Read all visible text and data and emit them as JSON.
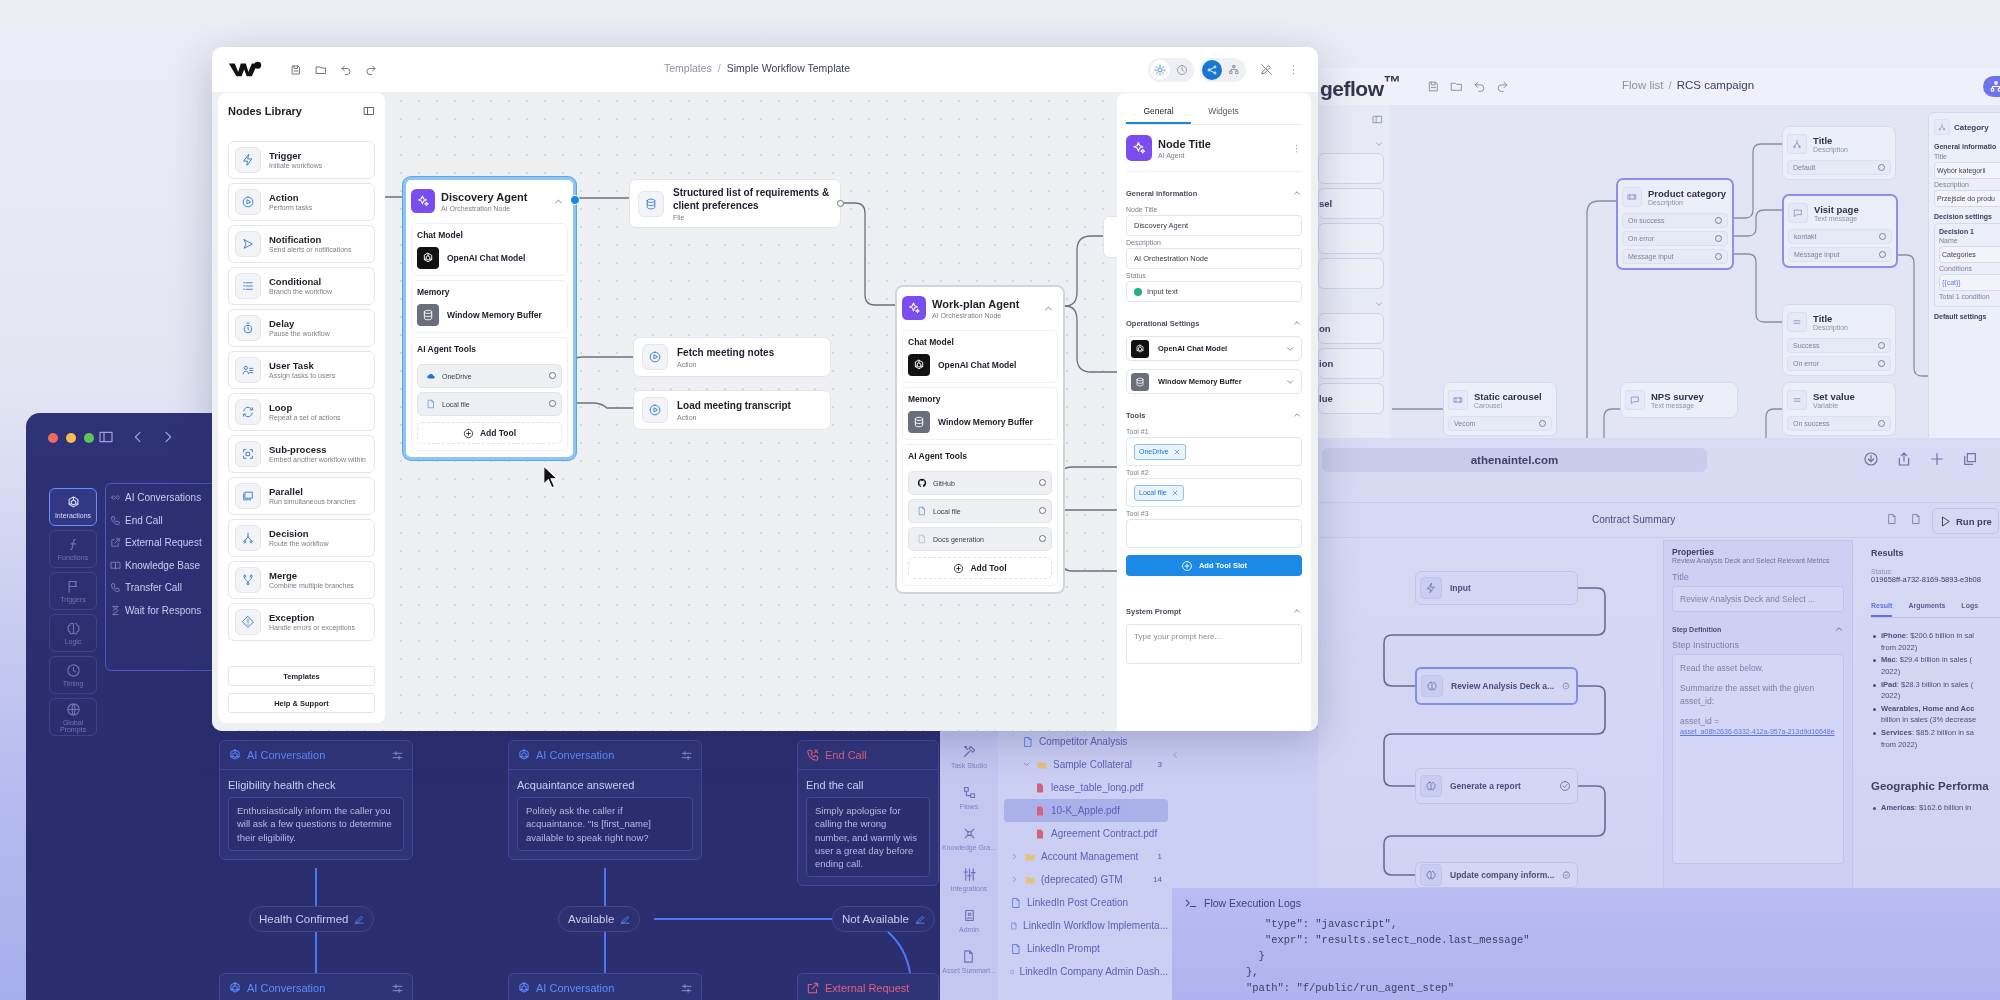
{
  "dark_window": {
    "rail": [
      {
        "kind": "ai",
        "label": "Interactions",
        "selected": true
      },
      {
        "kind": "function",
        "label": "Functions",
        "selected": false
      },
      {
        "kind": "flag",
        "label": "Triggers",
        "selected": false
      },
      {
        "kind": "brain",
        "label": "Logic",
        "selected": false
      },
      {
        "kind": "clock",
        "label": "Timing",
        "selected": false
      },
      {
        "kind": "globe",
        "label": "Global Prompts",
        "selected": false
      }
    ],
    "menu": [
      {
        "kind": "infinity",
        "label": "AI Conversations"
      },
      {
        "kind": "phone",
        "label": "End Call"
      },
      {
        "kind": "external",
        "label": "External Request"
      },
      {
        "kind": "book",
        "label": "Knowledge Base"
      },
      {
        "kind": "phone",
        "label": "Transfer Call"
      },
      {
        "kind": "hourglass",
        "label": "Wait for Respons"
      }
    ],
    "cards": [
      {
        "kind": "ai",
        "type": "AI Conversation",
        "title": "Eligibility health check",
        "body": "Enthusiastically inform the caller you will ask a few questions to determine their eligibility."
      },
      {
        "kind": "ai",
        "type": "AI Conversation",
        "title": "Acquaintance answered",
        "body": "Politely ask the caller if acquaintance. \"Is [first_name] available to speak right now?"
      },
      {
        "kind": "end",
        "type": "End Call",
        "title": "End the call",
        "body": "Simply apologise for calling the wrong number, and warmly wis user a great day before ending call."
      }
    ],
    "branches": [
      "Health Confirmed",
      "Available",
      "Not Available"
    ],
    "next_cards": [
      {
        "kind": "ai",
        "type": "AI Conversation"
      },
      {
        "kind": "ai",
        "type": "AI Conversation"
      },
      {
        "kind": "external",
        "type": "External Request"
      }
    ]
  },
  "main_window": {
    "breadcrumb": [
      "Templates",
      "Simple Workflow Template"
    ],
    "breadcrumb_separator": "/",
    "view_toggles": [
      {
        "kind": "sun",
        "selected": true
      },
      {
        "kind": "clock",
        "selected": false
      }
    ],
    "mode_toggles": [
      {
        "kind": "share",
        "selected": true
      },
      {
        "kind": "tree",
        "selected": false
      }
    ],
    "library": {
      "title": "Nodes Library",
      "items": [
        {
          "kind": "trigger",
          "label": "Trigger",
          "description": "Initiate workflows"
        },
        {
          "kind": "action",
          "label": "Action",
          "description": "Perform tasks"
        },
        {
          "kind": "notification",
          "label": "Notification",
          "description": "Send alerts or notifications"
        },
        {
          "kind": "conditional",
          "label": "Conditional",
          "description": "Branch the workflow"
        },
        {
          "kind": "delay",
          "label": "Delay",
          "description": "Pause the workflow"
        },
        {
          "kind": "usertask",
          "label": "User Task",
          "description": "Assign tasks to users"
        },
        {
          "kind": "loop",
          "label": "Loop",
          "description": "Repeat a set of actions"
        },
        {
          "kind": "subprocess",
          "label": "Sub-process",
          "description": "Embed another workflow within"
        },
        {
          "kind": "parallel",
          "label": "Parallel",
          "description": "Run simultaneous branches"
        },
        {
          "kind": "decision",
          "label": "Decision",
          "description": "Route the workflow"
        },
        {
          "kind": "merge",
          "label": "Merge",
          "description": "Combine multiple branches"
        },
        {
          "kind": "exception",
          "label": "Exception",
          "description": "Handle errors or exceptions"
        }
      ],
      "buttons": [
        "Templates",
        "Help & Support"
      ]
    },
    "canvas": {
      "agents": [
        {
          "title": "Discovery Agent",
          "subtitle": "AI Orchestration Node",
          "selected": true,
          "expanded": true,
          "chat_label": "Chat Model",
          "chat_model": "OpenAI Chat Model",
          "memory_label": "Memory",
          "memory": "Window Memory Buffer",
          "tools_label": "AI Agent Tools",
          "tools": [
            {
              "kind": "cloud",
              "label": "OneDrive"
            },
            {
              "kind": "file",
              "label": "Local file"
            }
          ],
          "add_label": "Add Tool"
        },
        {
          "title": "Work-plan Agent",
          "subtitle": "AI Orchestration Node",
          "selected": false,
          "expanded": true,
          "chat_label": "Chat Model",
          "chat_model": "OpenAI Chat Model",
          "memory_label": "Memory",
          "memory": "Window Memory Buffer",
          "tools_label": "AI Agent Tools",
          "tools": [
            {
              "kind": "github",
              "label": "GitHub"
            },
            {
              "kind": "file",
              "label": "Local file"
            },
            {
              "kind": "doc",
              "label": "Docs generation"
            }
          ],
          "add_label": "Add Tool"
        }
      ],
      "nodes": [
        {
          "kind": "database",
          "title": "Structured list of requirements & client preferences",
          "subtitle": "File"
        },
        {
          "kind": "action",
          "title": "Fetch meeting notes",
          "subtitle": "Action"
        },
        {
          "kind": "action",
          "title": "Load meeting transcript",
          "subtitle": "Action"
        }
      ]
    },
    "properties": {
      "tabs": [
        {
          "label": "General",
          "selected": true
        },
        {
          "label": "Widgets",
          "selected": false
        }
      ],
      "node_title": "Node Title",
      "node_type": "AI Agent",
      "general": {
        "title": "General information",
        "expanded": true,
        "fields": [
          {
            "kind": "text",
            "label": "Node Title",
            "value": "Discovery Agent"
          },
          {
            "kind": "text",
            "label": "Description",
            "value": "AI Orchestration Node"
          },
          {
            "kind": "status",
            "label": "Status",
            "value": "Input text"
          }
        ]
      },
      "operational": {
        "title": "Operational Settings",
        "expanded": true,
        "selects": [
          {
            "kind": "openai",
            "label": "OpenAI Chat Model"
          },
          {
            "kind": "memory",
            "label": "Window Memory Buffer"
          }
        ]
      },
      "tools": {
        "title": "Tools",
        "expanded": true,
        "slots": [
          {
            "label": "Tool #1",
            "chips": [
              "OneDrive"
            ]
          },
          {
            "label": "Tool #2",
            "chips": [
              "Local file"
            ]
          },
          {
            "label": "Tool #3"
          }
        ],
        "button": "Add Tool Slot"
      },
      "system_prompt": {
        "title": "System Prompt",
        "expanded": true,
        "placeholder": "Type your prompt here..."
      }
    }
  },
  "flow_window": {
    "logo": "geflow$^{™}$",
    "breadcrumb": [
      "Flow list",
      "RCS campaign"
    ],
    "breadcrumb_separator": "/",
    "sidebar": {
      "groups": [
        {
          "expanded": true,
          "cards": [
            {
              "kind": "blank"
            },
            {
              "kind": "titled",
              "title": "sel"
            },
            {
              "kind": "blank"
            },
            {
              "kind": "blank"
            }
          ]
        },
        {
          "expanded": true,
          "cards": [
            {
              "kind": "titled",
              "title": "on"
            },
            {
              "kind": "titled",
              "title": "ion"
            },
            {
              "kind": "titled",
              "title": "lue"
            }
          ]
        }
      ]
    },
    "nodes": [
      {
        "kind": "decision",
        "title": "Title",
        "subtitle": "Description",
        "selected": false,
        "rows": [
          "Default"
        ]
      },
      {
        "kind": "carousel",
        "title": "Product category",
        "subtitle": "Description",
        "selected": true,
        "rows": [
          "On success",
          "On error",
          "Message input"
        ]
      },
      {
        "kind": "message",
        "title": "Visit page",
        "subtitle": "Text message",
        "selected": true,
        "rows": [
          "kontakt",
          "Message input"
        ]
      },
      {
        "kind": "list",
        "title": "Title",
        "subtitle": "Description",
        "selected": false,
        "rows": [
          "Success",
          "On error"
        ]
      },
      {
        "kind": "carousel",
        "title": "Static carousel",
        "subtitle": "Carousel",
        "selected": false,
        "rows": [
          "Vecom"
        ]
      },
      {
        "kind": "message",
        "title": "NPS survey",
        "subtitle": "Text message",
        "selected": false
      },
      {
        "kind": "list",
        "title": "Set value",
        "subtitle": "Variable",
        "selected": false,
        "rows": [
          "On success"
        ]
      }
    ],
    "panel": {
      "title": "Category",
      "heading": "General informatio",
      "fields": [
        {
          "label": "Title",
          "value": "Wybór kategorii"
        },
        {
          "label": "Description",
          "value": "Przejście do produ"
        }
      ],
      "decision_heading": "Decision settings",
      "decision_title": "Decision 1",
      "name_label": "Name",
      "name_value": "Categories",
      "conditions_label": "Conditions",
      "condition": "{{cat}}",
      "total": "Total 1 condition",
      "default_heading": "Default settings"
    }
  },
  "browser_window": {
    "url": "athenaintel.com",
    "title": "Contract Summary",
    "run_button": "Run pre",
    "steps": [
      {
        "kind": "input",
        "label": "Input",
        "selected": false,
        "done": false
      },
      {
        "kind": "brain",
        "label": "Review Analysis Deck a...",
        "selected": true,
        "done": true
      },
      {
        "kind": "brain",
        "label": "Generate a report",
        "selected": false,
        "done": true
      },
      {
        "kind": "brain",
        "label": "Update company inform...",
        "selected": false,
        "done": true
      }
    ],
    "properties": {
      "title": "Properties",
      "subtitle": "Review Analysis Deck and Select Relevant Metrics",
      "field_label": "Title",
      "field_value": "Review Analysis Deck and Select ...",
      "section": "Step Definition",
      "instructions_label": "Step Instructions",
      "paragraphs": [
        "Read the asset below.",
        "Summarize the asset with the given asset_id:"
      ],
      "asset_label": "asset_id =",
      "asset_link": "asset_a08b2636-6332-412a-957a-213d9d16648e"
    },
    "results": {
      "title": "Results",
      "status_label": "Status:",
      "status_value": "019658ff-a732-8169-5893-e3b08",
      "tabs": [
        {
          "label": "Result",
          "selected": true
        },
        {
          "label": "Arguments",
          "selected": false
        },
        {
          "label": "Logs",
          "selected": false
        }
      ],
      "bullets": [
        {
          "lines": [
            "**iPhone**: $200.6 billion in sal",
            "from 2022)"
          ]
        },
        {
          "lines": [
            "**Mac**: $29.4 billion in sales (",
            "2022)"
          ]
        },
        {
          "lines": [
            "**iPad**: $28.3 billion in sales (",
            "2022)"
          ]
        },
        {
          "lines": [
            "**Wearables, Home and Acc**",
            "billion in sales (3% decrease"
          ]
        },
        {
          "lines": [
            "**Services**: $85.2 billion in sa",
            "from 2022)"
          ]
        }
      ],
      "heading": "Geographic Performa",
      "geo_bullets": [
        {
          "lines": [
            "**Americas**: $162.6 billion in"
          ]
        }
      ]
    }
  },
  "files_window": {
    "rail": [
      {
        "kind": "tools",
        "label": "Task Studio"
      },
      {
        "kind": "flows",
        "label": "Flows"
      },
      {
        "kind": "graph",
        "label": "Knowledge Gra..."
      },
      {
        "kind": "sliders",
        "label": "Integrations"
      },
      {
        "kind": "admin",
        "label": "Admin"
      },
      {
        "kind": "doc",
        "label": "Asset Summari..."
      }
    ],
    "files": [
      {
        "kind": "group",
        "children": [
          {
            "kind": "doc",
            "label": "Competitor Analysis",
            "selected": false
          },
          {
            "kind": "folder",
            "label": "Sample Collateral",
            "count": "3",
            "expanded": true,
            "selected": false,
            "children": [
              {
                "kind": "pdf",
                "label": "lease_table_long.pdf",
                "selected": false
              },
              {
                "kind": "pdf",
                "label": "10-K_Apple.pdf",
                "selected": true
              },
              {
                "kind": "pdf",
                "label": "Agreement Contract.pdf",
                "selected": false
              }
            ]
          }
        ]
      },
      {
        "kind": "folder",
        "label": "Account Management",
        "count": "1",
        "expanded": false,
        "selected": false
      },
      {
        "kind": "folder",
        "label": "(deprecated) GTM",
        "count": "14",
        "expanded": false,
        "selected": false
      },
      {
        "kind": "doc",
        "label": "LinkedIn Post Creation",
        "selected": false
      },
      {
        "kind": "doc",
        "label": "LinkedIn Workflow Implementa...",
        "selected": false
      },
      {
        "kind": "doc",
        "label": "LinkedIn Prompt",
        "selected": false
      },
      {
        "kind": "doc",
        "label": "LinkedIn Company Admin Dash...",
        "selected": false
      }
    ]
  },
  "logs_panel": {
    "title": "Flow Execution Logs",
    "code": "   \"type\": \"javascript\",\n   \"expr\": \"results.select_node.last_message\"\n  }\n},\n\"path\": \"f/public/run_agent_step\""
  }
}
